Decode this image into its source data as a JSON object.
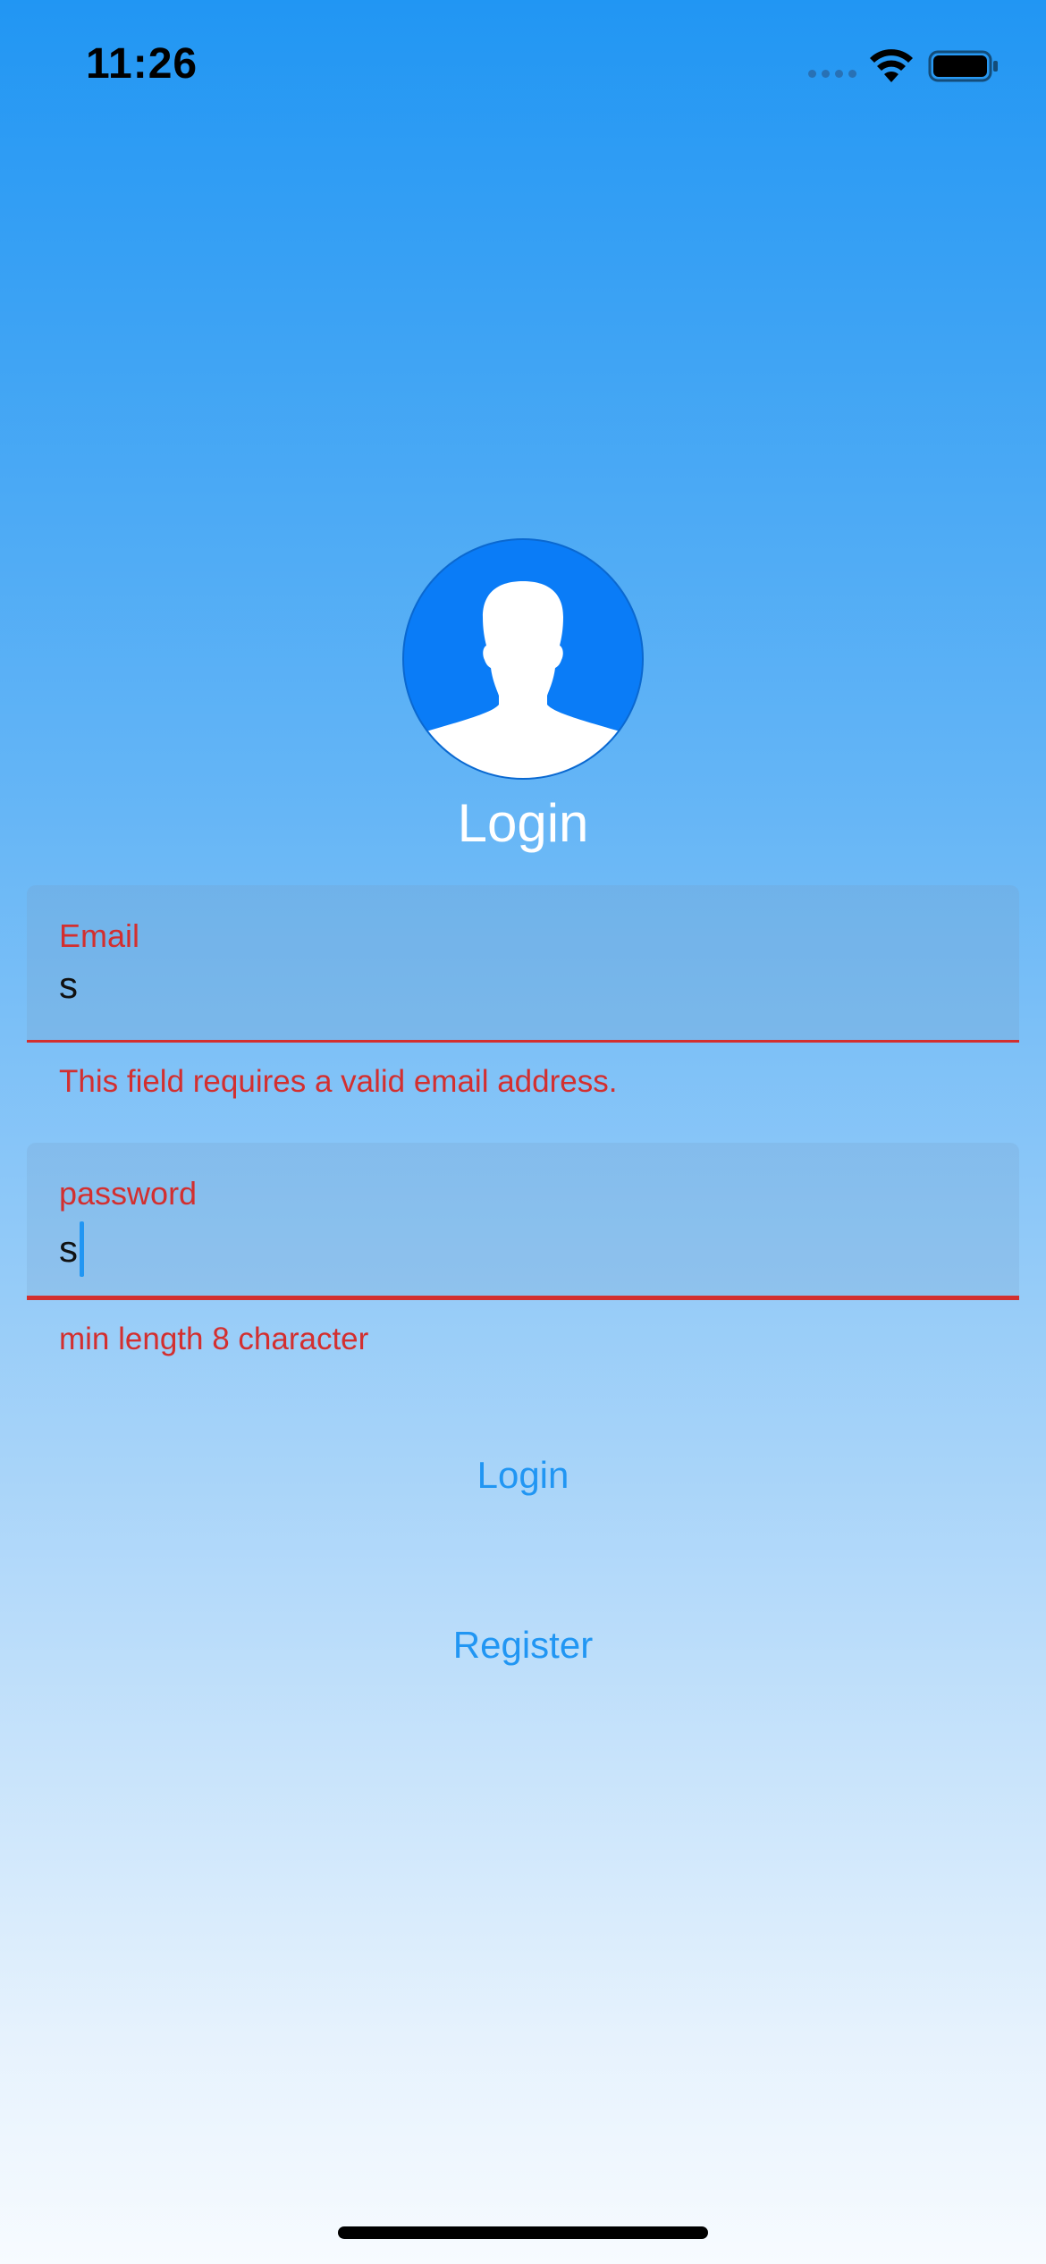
{
  "status_bar": {
    "time": "11:26",
    "icons": [
      "signal-icon",
      "wifi-icon",
      "battery-icon"
    ]
  },
  "avatar": {
    "icon": "user-silhouette-icon"
  },
  "title": "Login",
  "email_field": {
    "label": "Email",
    "value": "s",
    "error": "This field requires a valid email address."
  },
  "password_field": {
    "label": "password",
    "value": "s",
    "error": "min length 8 character"
  },
  "buttons": {
    "login": "Login",
    "register": "Register"
  },
  "colors": {
    "primary": "#2196f3",
    "error": "#d32f2f",
    "avatar": "#0a7cf7"
  }
}
